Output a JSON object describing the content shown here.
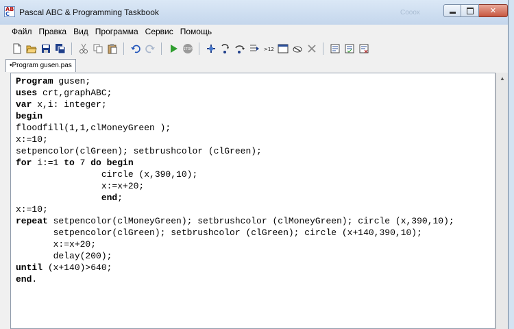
{
  "window": {
    "title": "Pascal ABC & Programming Taskbook",
    "ghost_title": "Сооох"
  },
  "app_icon": {
    "line1": "AB",
    "line2": "C"
  },
  "menu": [
    "Файл",
    "Правка",
    "Вид",
    "Программа",
    "Сервис",
    "Помощь"
  ],
  "toolbar": {
    "groups": [
      [
        "new-file",
        "open-folder",
        "save",
        "save-all"
      ],
      [
        "cut",
        "copy",
        "paste"
      ],
      [
        "undo",
        "redo"
      ],
      [
        "run",
        "stop"
      ],
      [
        "add-watch",
        "step-into",
        "step-over",
        "run-to-cursor",
        "show-output",
        "show-window",
        "hide-panel",
        "clear-output"
      ],
      [
        "task-1",
        "task-2",
        "task-3"
      ]
    ],
    "icons": {
      "new-file": "new-file-icon",
      "open-folder": "open-folder-icon",
      "save": "save-icon",
      "save-all": "save-all-icon",
      "cut": "scissors-icon",
      "copy": "copy-icon",
      "paste": "paste-icon",
      "undo": "undo-icon",
      "redo": "redo-icon",
      "run": "run-icon",
      "stop": "stop-icon",
      "add-watch": "add-watch-icon",
      "step-into": "step-into-icon",
      "step-over": "step-over-icon",
      "run-to-cursor": "run-to-cursor-icon",
      "show-output": "output-icon",
      "show-window": "window-icon",
      "hide-panel": "panel-icon",
      "clear-output": "close-x-icon",
      "task-1": "taskbook-icon",
      "task-2": "taskbook-icon",
      "task-3": "taskbook-icon"
    },
    "stop_label": "STOP",
    "output_label": ">123"
  },
  "tab": {
    "label": "•Program gusen.pas"
  },
  "code": {
    "lines": [
      [
        [
          "kw",
          "Program"
        ],
        [
          "",
          " gusen;"
        ]
      ],
      [
        [
          "kw",
          "uses"
        ],
        [
          "",
          " crt,graphABC;"
        ]
      ],
      [
        [
          "kw",
          "var"
        ],
        [
          "",
          " x,i: integer;"
        ]
      ],
      [
        [
          "kw",
          "begin"
        ]
      ],
      [
        [
          "",
          "floodfill(1,1,clMoneyGreen );"
        ]
      ],
      [
        [
          "",
          "x:=10;"
        ]
      ],
      [
        [
          "",
          "setpencolor(clGreen); setbrushcolor (clGreen);"
        ]
      ],
      [
        [
          "kw",
          "for"
        ],
        [
          "",
          " i:=1 "
        ],
        [
          "kw",
          "to"
        ],
        [
          "",
          " 7 "
        ],
        [
          "kw",
          "do"
        ],
        [
          "",
          " "
        ],
        [
          "kw",
          "begin"
        ]
      ],
      [
        [
          "",
          "                circle (x,390,10);"
        ]
      ],
      [
        [
          "",
          "                x:=x+20;"
        ]
      ],
      [
        [
          "",
          "                "
        ],
        [
          "kw",
          "end"
        ],
        [
          "",
          ";"
        ]
      ],
      [
        [
          "",
          "x:=10;"
        ]
      ],
      [
        [
          "kw",
          "repeat"
        ],
        [
          "",
          " setpencolor(clMoneyGreen); setbrushcolor (clMoneyGreen); circle (x,390,10);"
        ]
      ],
      [
        [
          "",
          "       setpencolor(clGreen); setbrushcolor (clGreen); circle (x+140,390,10);"
        ]
      ],
      [
        [
          "",
          "       x:=x+20;"
        ]
      ],
      [
        [
          "",
          "       delay(200);"
        ]
      ],
      [
        [
          "kw",
          "until"
        ],
        [
          "",
          " (x+140)>640;"
        ]
      ],
      [
        [
          "kw",
          "end"
        ],
        [
          "",
          "."
        ]
      ]
    ]
  },
  "colors": {
    "run": "#2f9e2f",
    "stop": "#9a9a9a",
    "save": "#1f3f8a",
    "folder": "#e8b84a",
    "undo": "#2255bb"
  }
}
